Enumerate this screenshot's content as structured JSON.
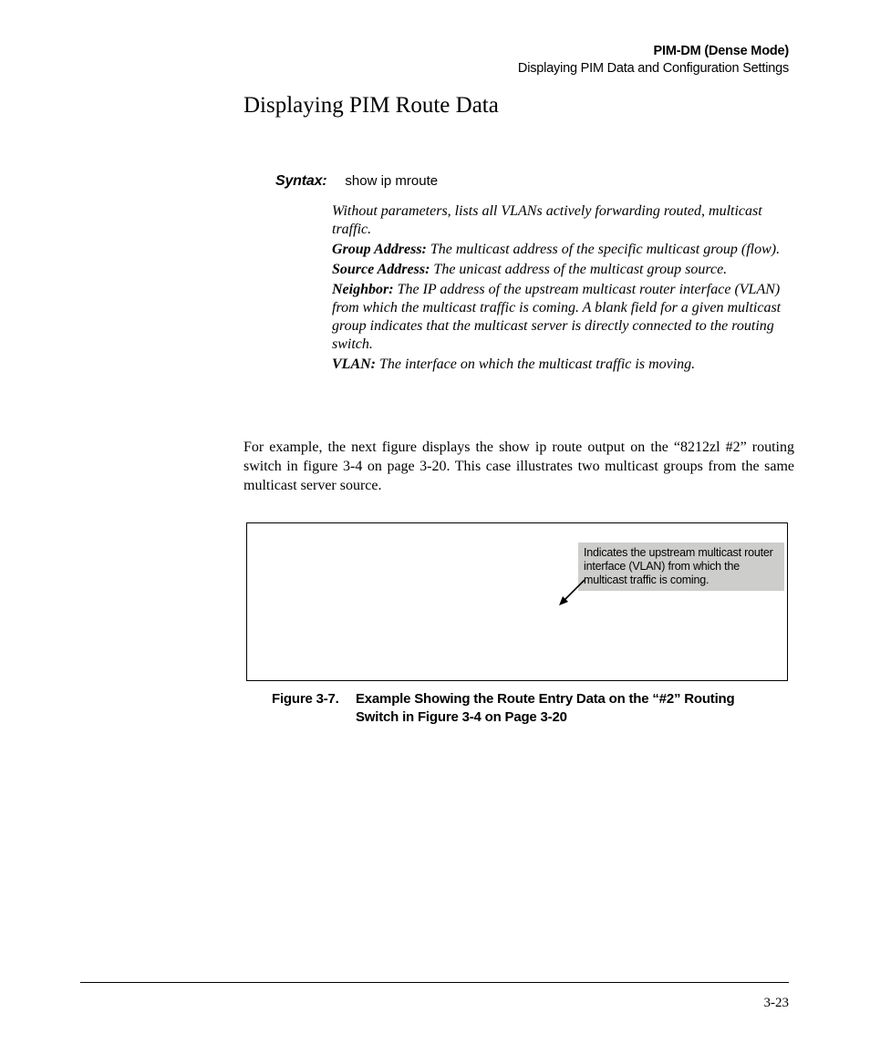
{
  "header": {
    "chapter": "PIM-DM (Dense Mode)",
    "section": "Displaying PIM Data and Configuration Settings"
  },
  "title": "Displaying PIM Route Data",
  "syntax": {
    "label": "Syntax:",
    "command": "show ip mroute",
    "intro": "Without parameters, lists all VLANs actively forwarding routed, multicast traffic.",
    "fields": {
      "group_label": "Group Address:",
      "group_text": " The multicast address of the specific multicast group (flow).",
      "source_label": "Source Address:",
      "source_text": " The  unicast address of the multicast group source.",
      "neighbor_label": "Neighbor:",
      "neighbor_text": " The IP address of the upstream multicast router interface (VLAN) from which the multicast traffic is coming. A blank field for a given multicast group indicates that the multicast server is directly connected to the routing switch.",
      "vlan_label": "VLAN:",
      "vlan_text": " The interface on which the multicast traffic is moving."
    }
  },
  "body_paragraph": "For example, the next figure displays the show ip route output on the “8212zl #2” routing switch in figure 3-4 on page 3-20. This case illustrates two multicast groups from the same multicast server source.",
  "figure": {
    "callout": "Indicates the upstream multicast router interface (VLAN) from which the multicast traffic is coming.",
    "caption_num": "Figure 3-7.",
    "caption_text": "Example Showing the Route Entry Data on the “#2” Routing Switch in Figure 3-4 on Page 3-20"
  },
  "page_number": "3-23"
}
